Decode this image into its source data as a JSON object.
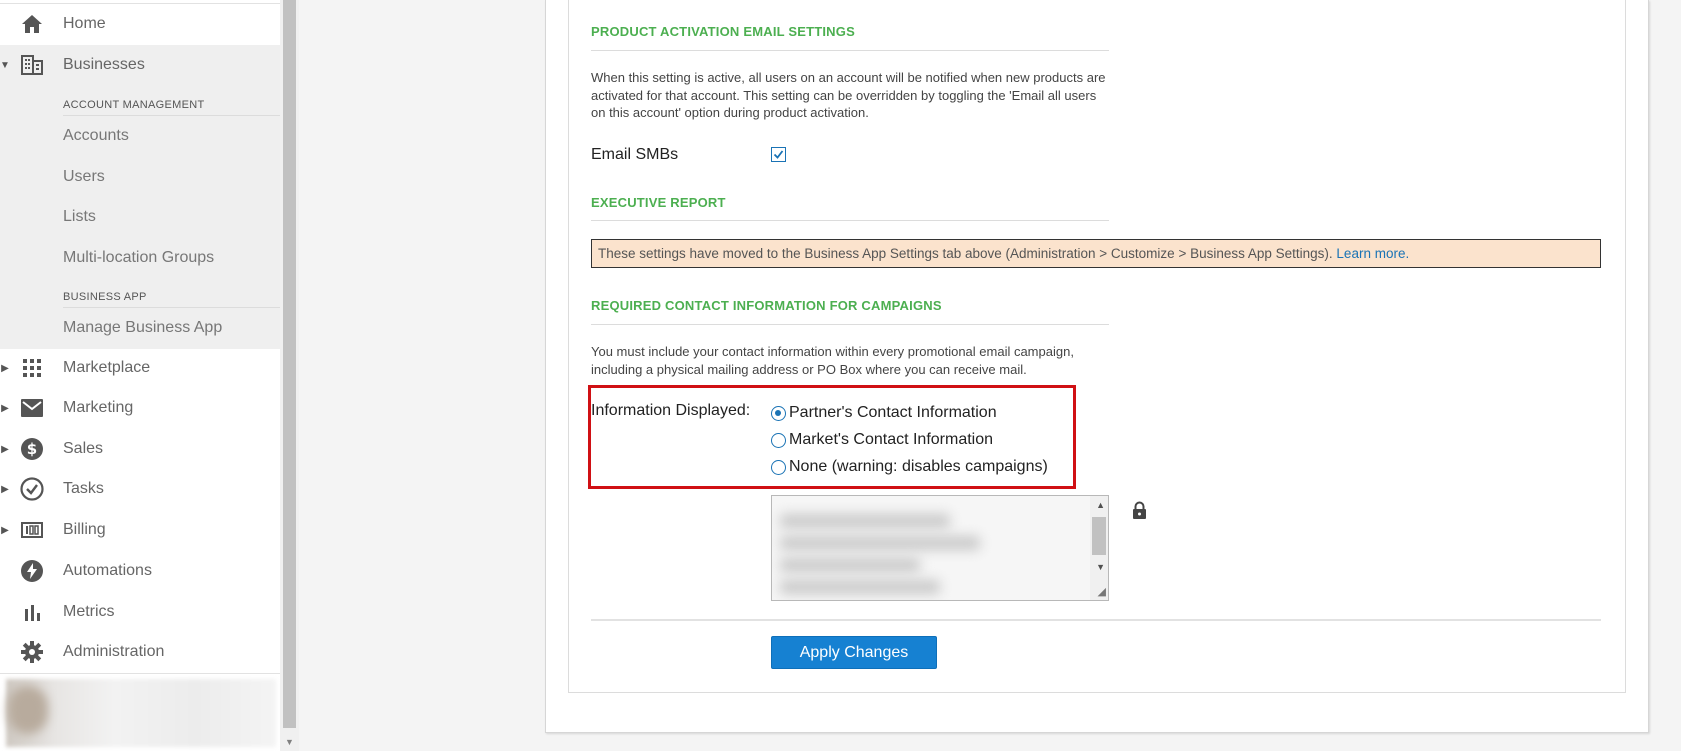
{
  "sidebar": {
    "home": "Home",
    "businesses": "Businesses",
    "account_management_header": "ACCOUNT MANAGEMENT",
    "accounts": "Accounts",
    "users": "Users",
    "lists": "Lists",
    "multi_location_groups": "Multi-location Groups",
    "business_app_header": "BUSINESS APP",
    "manage_business_app": "Manage Business App",
    "marketplace": "Marketplace",
    "marketing": "Marketing",
    "sales": "Sales",
    "tasks": "Tasks",
    "billing": "Billing",
    "automations": "Automations",
    "metrics": "Metrics",
    "administration": "Administration"
  },
  "product_activation": {
    "title": "PRODUCT ACTIVATION EMAIL SETTINGS",
    "description": "When this setting is active, all users on an account will be notified when new products are activated for that account. This setting can be overridden by toggling the 'Email all users on this account' option during product activation.",
    "email_smbs_label": "Email SMBs",
    "email_smbs_checked": true
  },
  "executive_report": {
    "title": "EXECUTIVE REPORT",
    "notice_text": "These settings have moved to the Business App Settings tab above (Administration > Customize > Business App Settings).",
    "notice_link": "Learn more."
  },
  "contact_info": {
    "title": "REQUIRED CONTACT INFORMATION FOR CAMPAIGNS",
    "description": "You must include your contact information within every promotional email campaign, including a physical mailing address or PO Box where you can receive mail.",
    "info_displayed_label": "Information Displayed:",
    "options": [
      "Partner's Contact Information",
      "Market's Contact Information",
      "None (warning: disables campaigns)"
    ],
    "selected_option": "Partner's Contact Information"
  },
  "apply_button": "Apply Changes",
  "colors": {
    "section_title": "#4caf50",
    "primary": "#1681d2",
    "highlight": "#d01014",
    "notice_bg": "#fbe3cd"
  }
}
